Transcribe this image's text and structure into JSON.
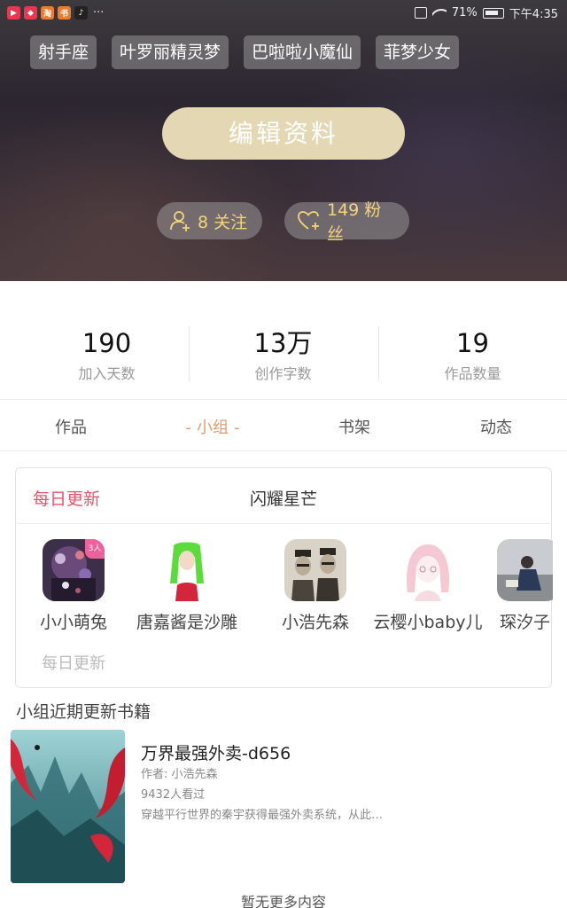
{
  "status_bar": {
    "battery": "71%",
    "time": "下午4:35",
    "more": "···",
    "apps": [
      {
        "icon": "video-app-icon",
        "color": "#e8384f",
        "glyph": "▶"
      },
      {
        "icon": "shop-app-icon",
        "color": "#e8384f",
        "glyph": "◆"
      },
      {
        "icon": "taobao-app-icon",
        "color": "#f07a2c",
        "glyph": "淘"
      },
      {
        "icon": "reader-app-icon",
        "color": "#f07a2c",
        "glyph": "书"
      },
      {
        "icon": "tiktok-app-icon",
        "color": "#222222",
        "glyph": "♪"
      }
    ]
  },
  "profile": {
    "tags": [
      "射手座",
      "叶罗丽精灵梦",
      "巴啦啦小魔仙",
      "菲梦少女"
    ],
    "edit_button": "编辑资料",
    "follow": "8 关注",
    "fans": "149 粉丝"
  },
  "stats": [
    {
      "value": "190",
      "label": "加入天数"
    },
    {
      "value": "13万",
      "label": "创作字数"
    },
    {
      "value": "19",
      "label": "作品数量"
    }
  ],
  "tabs": [
    "作品",
    "小组",
    "书架",
    "动态"
  ],
  "active_tab": "小组",
  "group": {
    "daily_label": "每日更新",
    "name": "闪耀星芒",
    "members": [
      {
        "name": "小小萌兔",
        "avatar": "avatar-dark-art",
        "badge": "3人"
      },
      {
        "name": "唐嘉酱是沙雕",
        "avatar": "avatar-green-hair-drawing"
      },
      {
        "name": "小浩先森",
        "avatar": "avatar-two-figures-sketch"
      },
      {
        "name": "云樱小baby儿",
        "avatar": "avatar-pink-anime-girl"
      },
      {
        "name": "琛汐子",
        "avatar": "avatar-person-sitting-photo"
      }
    ],
    "footer": "每日更新"
  },
  "recent": {
    "title": "小组近期更新书籍",
    "books": [
      {
        "title": "万界最强外卖-d656",
        "author": "作者: 小浩先森",
        "views": "9432人看过",
        "desc": "穿越平行世界的秦宇获得最强外卖系统，从此…"
      }
    ]
  },
  "no_more": "暂无更多内容",
  "colors": {
    "accent_gold": "#e4d8b4",
    "stat_yellow": "#f3d47a",
    "tab_active": "#e59a6a",
    "daily_red": "#e8536c"
  }
}
